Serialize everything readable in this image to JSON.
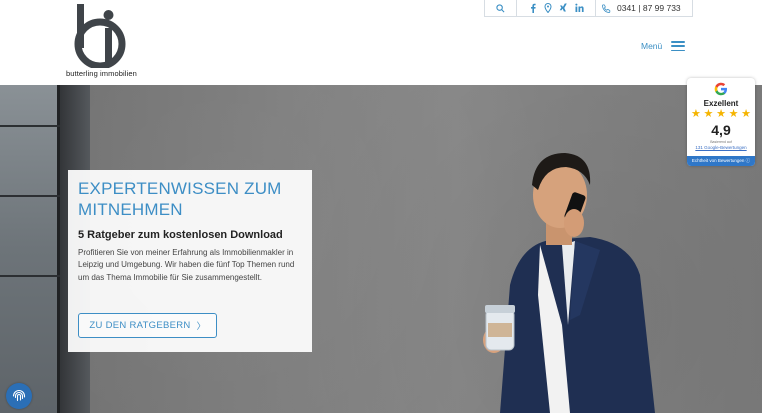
{
  "brand": {
    "name": "butterling immobilien"
  },
  "topbar": {
    "phone": "0341 | 87 99 733",
    "icons": [
      "search-icon",
      "facebook-icon",
      "location-icon",
      "xing-icon",
      "linkedin-icon",
      "phone-icon"
    ]
  },
  "nav": {
    "menu_label": "Menü"
  },
  "hero": {
    "title": "EXPERTENWISSEN ZUM MITNEHMEN",
    "subtitle": "5 Ratgeber zum kostenlosen Download",
    "text": "Profitieren Sie von meiner Erfahrung als Immobilien­makler in Leipzig und Umgebung. Wir haben die fünf Top Themen rund um das Thema Immobilie für Sie zusammengestellt.",
    "cta_label": "ZU DEN RATGEBERN",
    "cta_chevron": "〉"
  },
  "rating": {
    "label": "Exzellent",
    "stars": 5,
    "score": "4,9",
    "small_text": "Basierend auf",
    "count_text": "131 Google-Bewertungen",
    "footer": "Echtheit von Bewertungen ⓘ"
  },
  "colors": {
    "accent": "#3d8ec5",
    "star": "#f5b400",
    "badge": "#2b6fb6"
  }
}
